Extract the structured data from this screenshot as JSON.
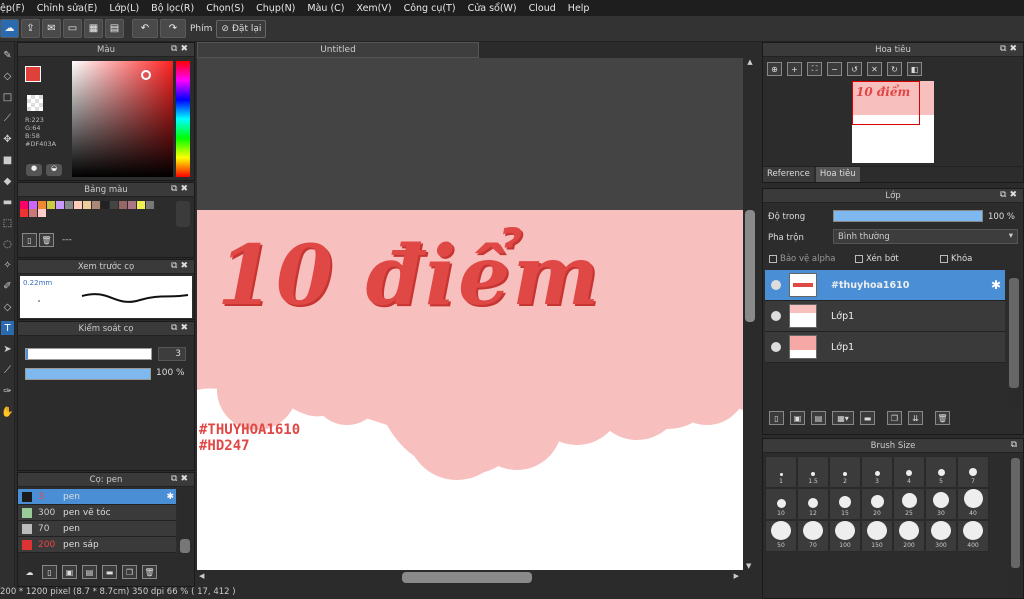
{
  "menu": [
    "ệp(F)",
    "Chỉnh sửa(E)",
    "Lớp(L)",
    "Bộ lọc(R)",
    "Chọn(S)",
    "Chụp(N)",
    "Màu (C)",
    "Xem(V)",
    "Công cụ(T)",
    "Cửa sổ(W)",
    "Cloud",
    "Help"
  ],
  "toolbar": {
    "phim_label": "Phím",
    "reset_label": "Đặt lại"
  },
  "document": {
    "tab_title": "Untitled"
  },
  "color_panel": {
    "title": "Màu",
    "r": "R:223",
    "g": "G:64",
    "b": "B:58",
    "hex": "#DF403A",
    "primary": "#DF403A"
  },
  "palette_panel": {
    "title": "Bảng màu",
    "dash": "---",
    "swatches": [
      "#f06",
      "#c6f",
      "#e83",
      "#cc4",
      "#c9f",
      "#888",
      "#fcb",
      "#ec9",
      "#a87",
      "#222",
      "#444",
      "#966",
      "#a78",
      "#ee5",
      "#777",
      "#e33",
      "#c77",
      "#fcc"
    ]
  },
  "brush_preview": {
    "title": "Xem trước cọ",
    "size": "0.22mm"
  },
  "brush_control": {
    "title": "Kiểm soát cọ",
    "size_value": "3",
    "opacity_value": "100 %"
  },
  "brush_list": {
    "title": "Cọ: pen",
    "items": [
      {
        "num": "3",
        "name": "pen",
        "color": "#1a1a1a"
      },
      {
        "num": "300",
        "name": "pen vẽ tóc",
        "color": "#9c9"
      },
      {
        "num": "70",
        "name": "pen",
        "color": "#bbb"
      },
      {
        "num": "200",
        "name": "pen sáp",
        "color": "#d33"
      }
    ]
  },
  "artwork": {
    "title_text": "10 điểm",
    "tag1": "#THUYHOA1610",
    "tag2": "#HD247"
  },
  "navigator": {
    "title": "Hoa tiêu",
    "tab_reference": "Reference",
    "tab_navigator": "Hoa tiêu"
  },
  "layer_panel": {
    "title": "Lớp",
    "opacity_label": "Độ trong",
    "opacity_value": "100 %",
    "blend_label": "Pha trộn",
    "blend_value": "Bình thường",
    "protect_alpha": "Bảo vệ alpha",
    "clip": "Xén bớt",
    "lock": "Khóa",
    "layers": [
      {
        "name": "#thuyhoa1610",
        "selected": true
      },
      {
        "name": "Lớp1",
        "selected": false
      },
      {
        "name": "Lớp1",
        "selected": false
      }
    ]
  },
  "brush_size_panel": {
    "title": "Brush Size",
    "sizes": [
      "1",
      "1.5",
      "2",
      "3",
      "4",
      "5",
      "7",
      "10",
      "12",
      "15",
      "20",
      "25",
      "30",
      "40",
      "50",
      "70",
      "100",
      "150",
      "200",
      "300",
      "400"
    ]
  },
  "status": {
    "text": "200 * 1200 pixel  (8.7 * 8.7cm)  350 dpi  66 %  ( 17, 412 )"
  }
}
